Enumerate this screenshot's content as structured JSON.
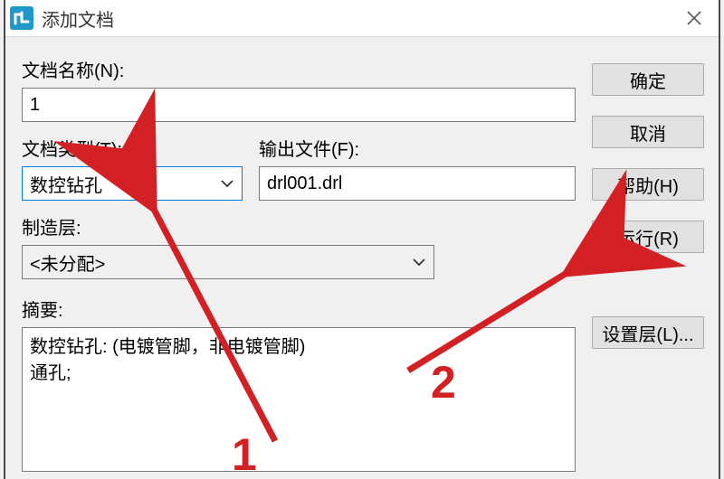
{
  "window": {
    "title": "添加文档",
    "close_icon": "close-icon"
  },
  "labels": {
    "doc_name": "文档名称(N):",
    "doc_type": "文档类型(T):",
    "output_file": "输出文件(F):",
    "mfg_layer": "制造层:",
    "summary": "摘要:"
  },
  "values": {
    "doc_name": "1",
    "doc_type": "数控钻孔",
    "output_file": "drl001.drl",
    "mfg_layer": "<未分配>",
    "summary": "数控钻孔: (电镀管脚，非电镀管脚)\n通孔;"
  },
  "buttons": {
    "ok": "确定",
    "cancel": "取消",
    "help": "帮助(H)",
    "run": "运行(R)",
    "set_layer": "设置层(L)..."
  },
  "annotations": {
    "num1": "1",
    "num2": "2"
  }
}
